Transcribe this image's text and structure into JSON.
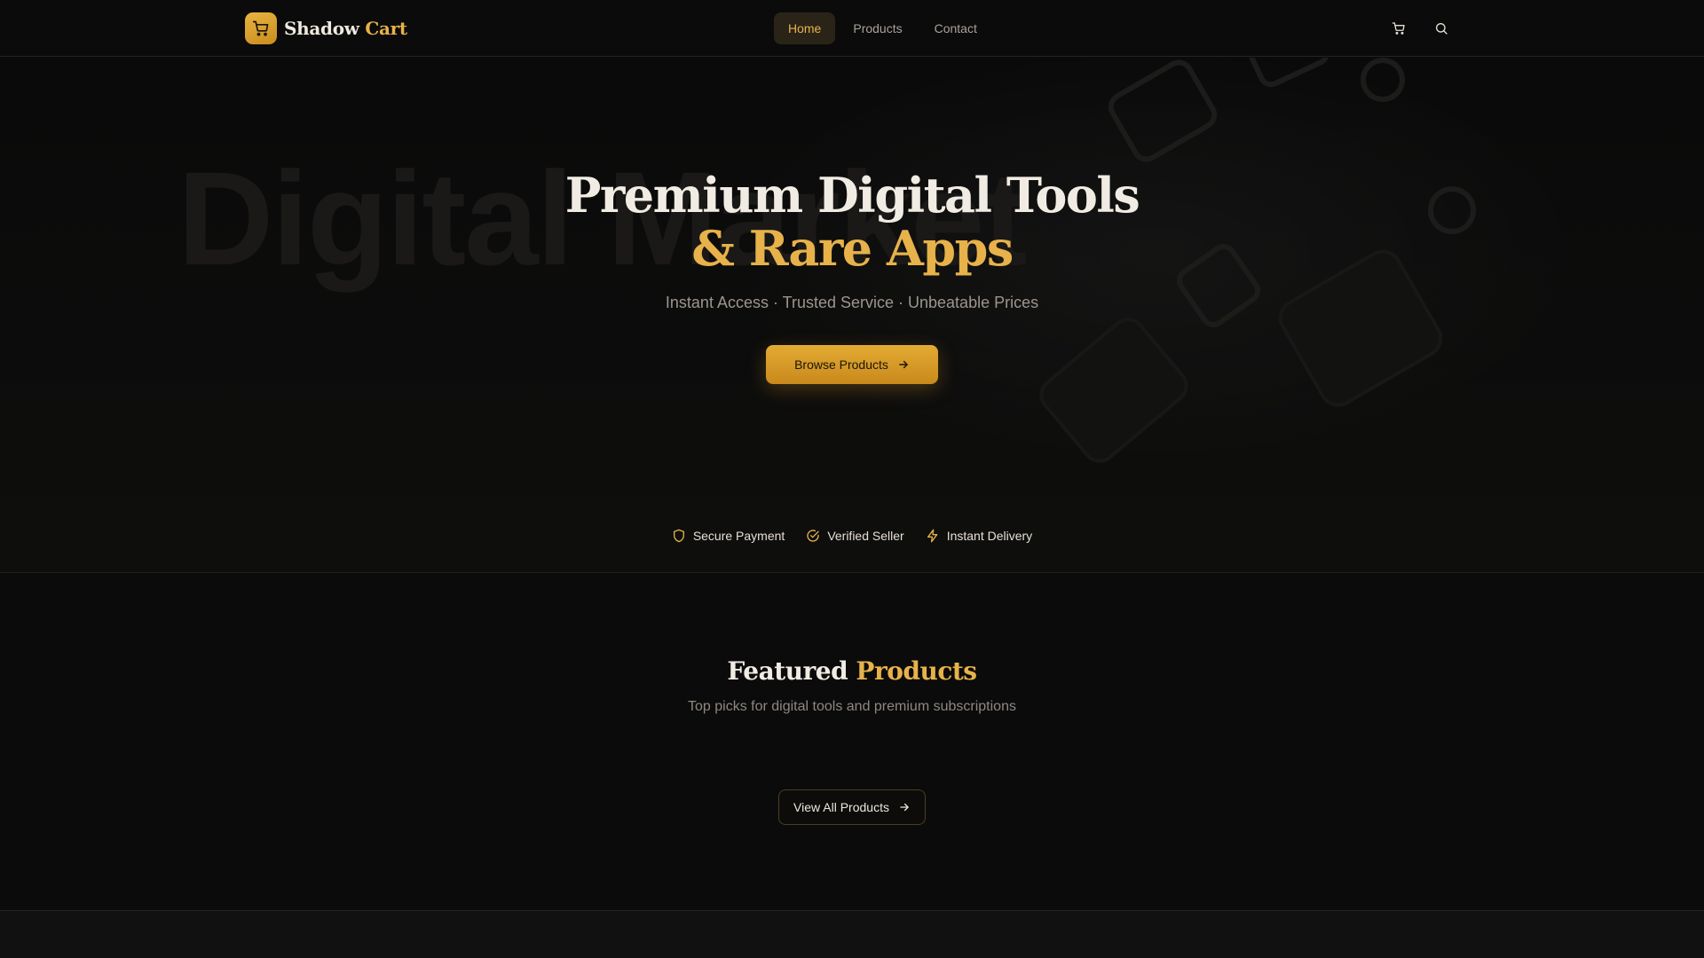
{
  "brand": {
    "name_part1": "Shadow",
    "name_part2": "Cart"
  },
  "nav": {
    "items": [
      {
        "label": "Home",
        "active": true
      },
      {
        "label": "Products",
        "active": false
      },
      {
        "label": "Contact",
        "active": false
      }
    ]
  },
  "header_icons": [
    "cart-icon",
    "search-icon"
  ],
  "hero": {
    "watermark": "Digital Market",
    "title_line1": "Premium Digital Tools",
    "title_line2": "& Rare Apps",
    "subtitle": "Instant Access · Trusted Service · Unbeatable Prices",
    "cta_label": "Browse Products"
  },
  "trust_badges": [
    {
      "icon": "shield-icon",
      "label": "Secure Payment"
    },
    {
      "icon": "check-circle-icon",
      "label": "Verified Seller"
    },
    {
      "icon": "lightning-icon",
      "label": "Instant Delivery"
    }
  ],
  "featured": {
    "title_part1": "Featured",
    "title_part2": "Products",
    "subtitle": "Top picks for digital tools and premium subscriptions",
    "view_all_label": "View All Products"
  },
  "colors": {
    "accent": "#e7b24a",
    "background": "#0b0b0b",
    "text": "#ece7de",
    "muted": "#9c968d"
  }
}
